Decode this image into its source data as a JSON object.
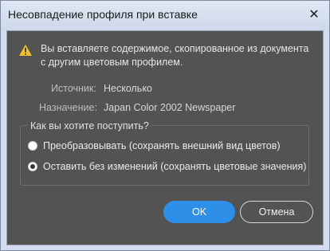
{
  "window": {
    "title": "Несовпадение профиля при вставке",
    "close_glyph": "✕"
  },
  "dialog": {
    "message": "Вы вставляете содержимое, скопированное из документа с другим цветовым профилем.",
    "source_label": "Источник:",
    "source_value": "Несколько",
    "destination_label": "Назначение:",
    "destination_value": "Japan Color 2002 Newspaper",
    "question": "Как вы хотите поступить?",
    "options": [
      {
        "label": "Преобразовывать (сохранять внешний вид цветов)",
        "selected": false
      },
      {
        "label": "Оставить без изменений (сохранять цветовые значения)",
        "selected": true
      }
    ],
    "ok_label": "OK",
    "cancel_label": "Отмена"
  },
  "colors": {
    "dialog_bg": "#535353",
    "accent": "#2d8fe8",
    "warning": "#f2c12e"
  },
  "icons": {
    "warning": "warning-icon",
    "close": "close-icon"
  }
}
